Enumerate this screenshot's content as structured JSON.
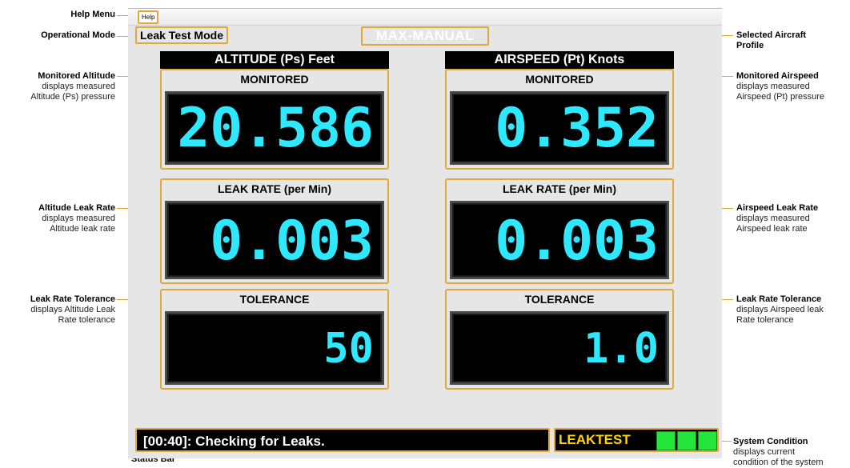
{
  "callouts": {
    "help_menu": {
      "title": "Help Menu"
    },
    "operational_mode": {
      "title": "Operational Mode"
    },
    "monitored_altitude": {
      "title": "Monitored Altitude",
      "lines": [
        "displays measured",
        "Altitude (Ps) pressure"
      ]
    },
    "altitude_leak_rate": {
      "title": "Altitude Leak Rate",
      "lines": [
        "displays measured",
        "Altitude leak rate"
      ]
    },
    "altitude_tolerance": {
      "title": "Leak Rate Tolerance",
      "lines": [
        "displays Altitude Leak",
        "Rate tolerance"
      ]
    },
    "status_bar": {
      "title": "Status Bar"
    },
    "selected_profile": {
      "title": "Selected Aircraft",
      "title2": "Profile"
    },
    "monitored_airspeed": {
      "title": "Monitored Airspeed",
      "lines": [
        "displays measured",
        "Airspeed (Pt) pressure"
      ]
    },
    "airspeed_leak_rate": {
      "title": "Airspeed Leak Rate",
      "lines": [
        "displays measured",
        "Airspeed leak rate"
      ]
    },
    "airspeed_tolerance": {
      "title": "Leak Rate Tolerance",
      "lines": [
        "displays Airspeed leak",
        "Rate tolerance"
      ]
    },
    "system_condition": {
      "title": "System Condition",
      "lines": [
        "displays current",
        "condition of the system"
      ]
    }
  },
  "app": {
    "menu": {
      "help": "Help"
    },
    "mode": "Leak Test Mode",
    "profile": "MAX-MANUAL",
    "altitude": {
      "title": "ALTITUDE (Ps) Feet",
      "monitored_label": "MONITORED",
      "monitored_value": "20.586",
      "leak_label": "LEAK RATE (per Min)",
      "leak_value": "0.003",
      "tolerance_label": "TOLERANCE",
      "tolerance_value": "50"
    },
    "airspeed": {
      "title": "AIRSPEED (Pt) Knots",
      "monitored_label": "MONITORED",
      "monitored_value": "0.352",
      "leak_label": "LEAK RATE (per Min)",
      "leak_value": "0.003",
      "tolerance_label": "TOLERANCE",
      "tolerance_value": "1.0"
    },
    "status": "[00:40]: Checking for Leaks.",
    "system_state": "LEAKTEST",
    "colors": {
      "accent": "#e0a93b",
      "lcd_text": "#2ee8ff",
      "status_ok": "#24e63a",
      "state_text": "#ffd500"
    }
  }
}
